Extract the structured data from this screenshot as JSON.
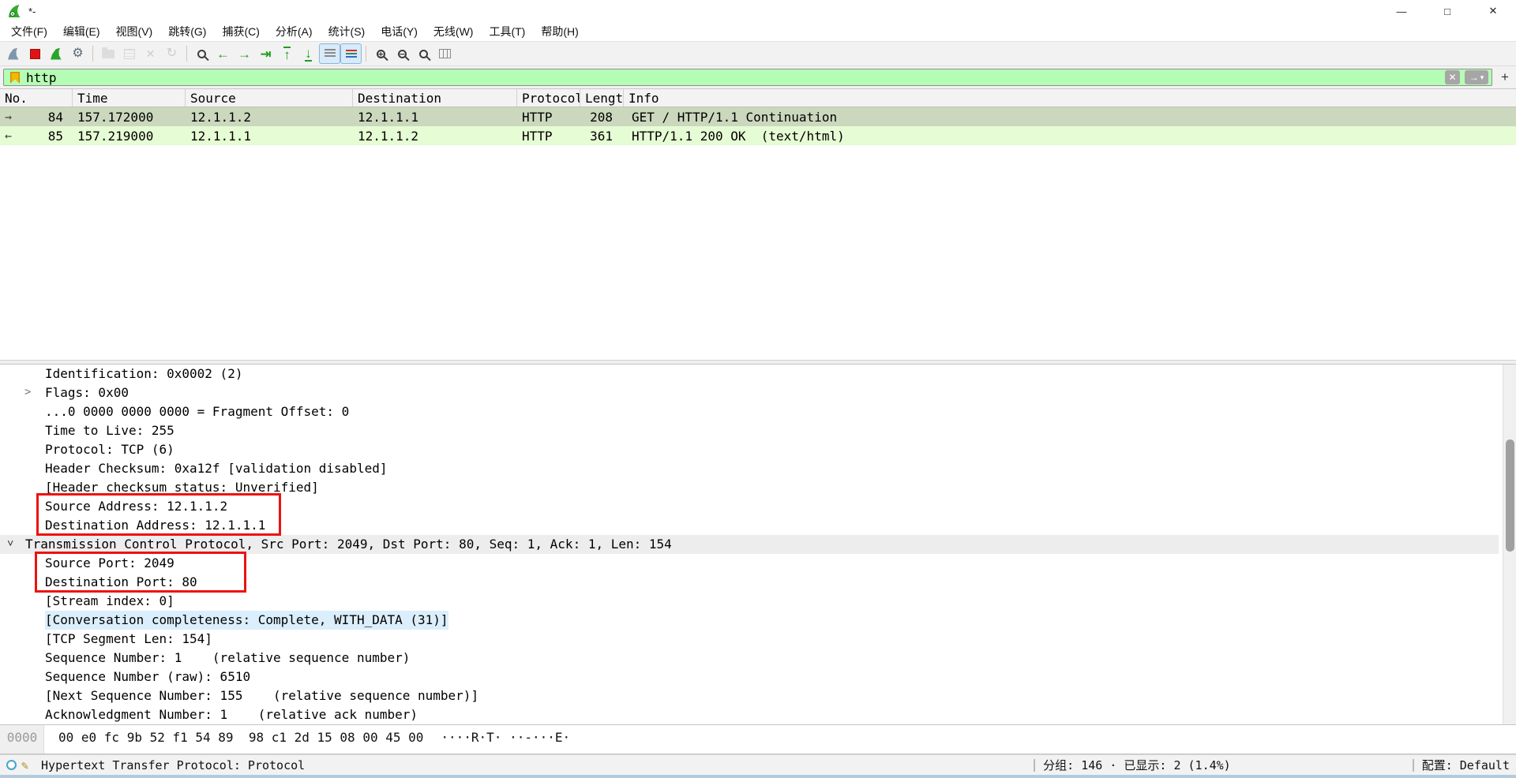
{
  "window": {
    "title": "*-",
    "controls": {
      "minimize": "—",
      "maximize": "□",
      "close": "✕"
    }
  },
  "menu": {
    "items": [
      "文件(F)",
      "编辑(E)",
      "视图(V)",
      "跳转(G)",
      "捕获(C)",
      "分析(A)",
      "统计(S)",
      "电话(Y)",
      "无线(W)",
      "工具(T)",
      "帮助(H)"
    ]
  },
  "toolbar": {
    "groups": [
      [
        "start-capture",
        "stop-capture",
        "restart-capture",
        "capture-options"
      ],
      [
        "open-file",
        "save-file",
        "close-file",
        "reload"
      ],
      [
        "find-packet",
        "go-back",
        "go-forward",
        "go-to-packet",
        "go-first",
        "go-last",
        "auto-scroll",
        "colorize"
      ],
      [
        "zoom-in",
        "zoom-out",
        "zoom-reset",
        "resize-columns"
      ]
    ],
    "disabled": [
      "open-file",
      "save-file",
      "close-file",
      "reload"
    ],
    "highlighted": [
      "auto-scroll",
      "colorize"
    ]
  },
  "filter": {
    "value": "http",
    "plus_label": "+"
  },
  "packet_list": {
    "columns": [
      "No.",
      "Time",
      "Source",
      "Destination",
      "Protocol",
      "Length",
      "Info"
    ],
    "rows": [
      {
        "marker": "→",
        "no": "84",
        "time": "157.172000",
        "source": "12.1.1.2",
        "destination": "12.1.1.1",
        "protocol": "HTTP",
        "length": "208",
        "info": "GET / HTTP/1.1 Continuation",
        "selected": true
      },
      {
        "marker": "←",
        "no": "85",
        "time": "157.219000",
        "source": "12.1.1.1",
        "destination": "12.1.1.2",
        "protocol": "HTTP",
        "length": "361",
        "info": "HTTP/1.1 200 OK  (text/html)",
        "selected": false
      }
    ]
  },
  "details": {
    "lines": [
      {
        "text": "Identification: 0x0002 (2)",
        "indent": 1
      },
      {
        "text": "Flags: 0x00",
        "indent": 1,
        "expander": "closed"
      },
      {
        "text": "...0 0000 0000 0000 = Fragment Offset: 0",
        "indent": 1
      },
      {
        "text": "Time to Live: 255",
        "indent": 1
      },
      {
        "text": "Protocol: TCP (6)",
        "indent": 1
      },
      {
        "text": "Header Checksum: 0xa12f [validation disabled]",
        "indent": 1
      },
      {
        "text": "[Header checksum status: Unverified]",
        "indent": 1
      },
      {
        "text": "Source Address: 12.1.1.2",
        "indent": 1
      },
      {
        "text": "Destination Address: 12.1.1.1",
        "indent": 1
      },
      {
        "text": "Transmission Control Protocol, Src Port: 2049, Dst Port: 80, Seq: 1, Ack: 1, Len: 154",
        "indent": 0,
        "expander": "open",
        "row_highlight": true
      },
      {
        "text": "Source Port: 2049",
        "indent": 1
      },
      {
        "text": "Destination Port: 80",
        "indent": 1
      },
      {
        "text": "[Stream index: 0]",
        "indent": 1
      },
      {
        "text": "[Conversation completeness: Complete, WITH_DATA (31)]",
        "indent": 1,
        "field_highlight": true
      },
      {
        "text": "[TCP Segment Len: 154]",
        "indent": 1
      },
      {
        "text": "Sequence Number: 1    (relative sequence number)",
        "indent": 1
      },
      {
        "text": "Sequence Number (raw): 6510",
        "indent": 1
      },
      {
        "text": "[Next Sequence Number: 155    (relative sequence number)]",
        "indent": 1
      },
      {
        "text": "Acknowledgment Number: 1    (relative ack number)",
        "indent": 1
      }
    ]
  },
  "hex": {
    "offset": "0000",
    "bytes": "00 e0 fc 9b 52 f1 54 89  98 c1 2d 15 08 00 45 00",
    "ascii": "····R·T· ··-···E·"
  },
  "status": {
    "message": "Hypertext Transfer Protocol: Protocol",
    "packets": "分组: 146 · 已显示: 2 (1.4%)",
    "profile": "配置: Default"
  },
  "colors": {
    "row_selected_bg": "#cbd8bd",
    "row_http_bg": "#e6fcd4",
    "detail_row_highlight": "#ededed",
    "field_highlight": "#dbeefb",
    "annotation_red": "#ee1111",
    "filter_bg": "#b5fcb5"
  }
}
